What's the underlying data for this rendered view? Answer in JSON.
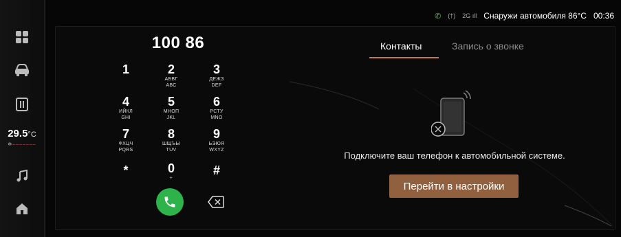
{
  "status_bar": {
    "outside_label": "Снаружи автомобиля 86°C",
    "time": "00:36",
    "signal_text": "2G",
    "hotspot_text": "(†)"
  },
  "sidebar": {
    "climate_temp": "29.5",
    "climate_unit": "°C",
    "items": [
      {
        "name": "apps"
      },
      {
        "name": "car"
      },
      {
        "name": "phone-card"
      },
      {
        "name": "music"
      },
      {
        "name": "home"
      }
    ]
  },
  "dialer": {
    "number": "100 86",
    "keys": [
      {
        "digit": "1",
        "sub1": "",
        "sub2": ""
      },
      {
        "digit": "2",
        "sub1": "АБВГ",
        "sub2": "ABC"
      },
      {
        "digit": "3",
        "sub1": "ДЕЖЗ",
        "sub2": "DEF"
      },
      {
        "digit": "4",
        "sub1": "ИЙКЛ",
        "sub2": "GHI"
      },
      {
        "digit": "5",
        "sub1": "МНОП",
        "sub2": "JKL"
      },
      {
        "digit": "6",
        "sub1": "РСТУ",
        "sub2": "MNO"
      },
      {
        "digit": "7",
        "sub1": "ФХЦЧ",
        "sub2": "PQRS"
      },
      {
        "digit": "8",
        "sub1": "ШЩЪЫ",
        "sub2": "TUV"
      },
      {
        "digit": "9",
        "sub1": "ЬЭЮЯ",
        "sub2": "WXYZ"
      },
      {
        "digit": "*",
        "sub1": "",
        "sub2": ""
      },
      {
        "digit": "0",
        "sub1": "+",
        "sub2": ""
      },
      {
        "digit": "#",
        "sub1": "",
        "sub2": ""
      }
    ]
  },
  "tabs": {
    "contacts": "Контакты",
    "call_log": "Запись о звонке"
  },
  "empty_state": {
    "message": "Подключите ваш телефон к автомобильной системе.",
    "button": "Перейти в настройки"
  },
  "colors": {
    "accent": "#c07a4d",
    "button": "#91603f",
    "call": "#2db34a"
  }
}
